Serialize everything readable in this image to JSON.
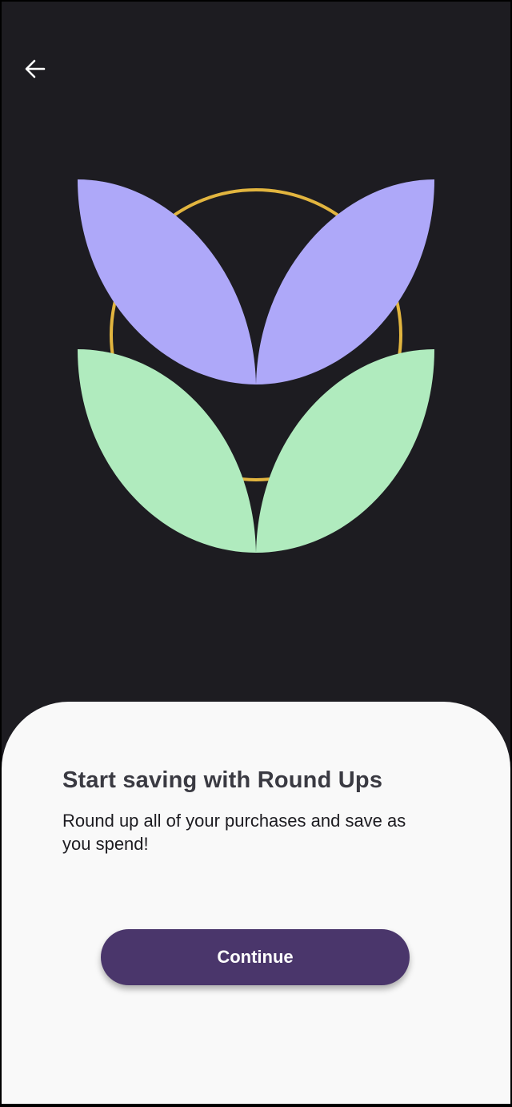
{
  "header": {
    "back_icon": "arrow-left-icon"
  },
  "illustration": {
    "description_icon": "tulip-icon",
    "colors": {
      "background": "#1d1c21",
      "petals": "#aea8f9",
      "leaves": "#b0ebbe",
      "ring": "#e2b53f"
    }
  },
  "sheet": {
    "title": "Start saving with Round Ups",
    "subtitle": "Round up all of your purchases and save as you spend!",
    "continue_label": "Continue",
    "button_color": "#4a366b"
  }
}
